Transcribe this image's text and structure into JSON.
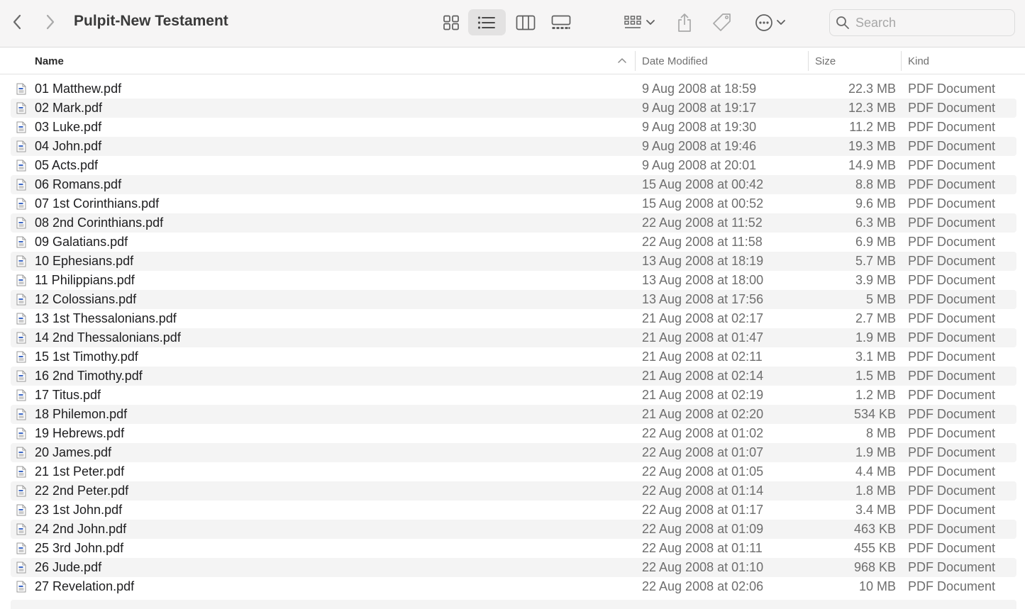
{
  "window": {
    "title": "Pulpit-New Testament"
  },
  "search": {
    "placeholder": "Search",
    "value": ""
  },
  "toolbar": {
    "icons": [
      "chevron-left-icon",
      "chevron-right-icon",
      "icon-view-icon",
      "list-view-icon",
      "column-view-icon",
      "gallery-view-icon",
      "group-icon",
      "share-icon",
      "tag-icon",
      "more-icon",
      "search-icon"
    ],
    "active_view": "list"
  },
  "columns": {
    "name": "Name",
    "date": "Date Modified",
    "size": "Size",
    "kind": "Kind",
    "sort_column": "name",
    "sort_direction": "ascending"
  },
  "files": [
    {
      "name": "01 Matthew.pdf",
      "date": "9 Aug 2008 at 18:59",
      "size": "22.3 MB",
      "kind": "PDF Document"
    },
    {
      "name": "02 Mark.pdf",
      "date": "9 Aug 2008 at 19:17",
      "size": "12.3 MB",
      "kind": "PDF Document"
    },
    {
      "name": "03 Luke.pdf",
      "date": "9 Aug 2008 at 19:30",
      "size": "11.2 MB",
      "kind": "PDF Document"
    },
    {
      "name": "04 John.pdf",
      "date": "9 Aug 2008 at 19:46",
      "size": "19.3 MB",
      "kind": "PDF Document"
    },
    {
      "name": "05 Acts.pdf",
      "date": "9 Aug 2008 at 20:01",
      "size": "14.9 MB",
      "kind": "PDF Document"
    },
    {
      "name": "06 Romans.pdf",
      "date": "15 Aug 2008 at 00:42",
      "size": "8.8 MB",
      "kind": "PDF Document"
    },
    {
      "name": "07 1st Corinthians.pdf",
      "date": "15 Aug 2008 at 00:52",
      "size": "9.6 MB",
      "kind": "PDF Document"
    },
    {
      "name": "08 2nd Corinthians.pdf",
      "date": "22 Aug 2008 at 11:52",
      "size": "6.3 MB",
      "kind": "PDF Document"
    },
    {
      "name": "09 Galatians.pdf",
      "date": "22 Aug 2008 at 11:58",
      "size": "6.9 MB",
      "kind": "PDF Document"
    },
    {
      "name": "10 Ephesians.pdf",
      "date": "13 Aug 2008 at 18:19",
      "size": "5.7 MB",
      "kind": "PDF Document"
    },
    {
      "name": "11 Philippians.pdf",
      "date": "13 Aug 2008 at 18:00",
      "size": "3.9 MB",
      "kind": "PDF Document"
    },
    {
      "name": "12 Colossians.pdf",
      "date": "13 Aug 2008 at 17:56",
      "size": "5 MB",
      "kind": "PDF Document"
    },
    {
      "name": "13 1st Thessalonians.pdf",
      "date": "21 Aug 2008 at 02:17",
      "size": "2.7 MB",
      "kind": "PDF Document"
    },
    {
      "name": "14 2nd Thessalonians.pdf",
      "date": "21 Aug 2008 at 01:47",
      "size": "1.9 MB",
      "kind": "PDF Document"
    },
    {
      "name": "15 1st Timothy.pdf",
      "date": "21 Aug 2008 at 02:11",
      "size": "3.1 MB",
      "kind": "PDF Document"
    },
    {
      "name": "16 2nd Timothy.pdf",
      "date": "21 Aug 2008 at 02:14",
      "size": "1.5 MB",
      "kind": "PDF Document"
    },
    {
      "name": "17 Titus.pdf",
      "date": "21 Aug 2008 at 02:19",
      "size": "1.2 MB",
      "kind": "PDF Document"
    },
    {
      "name": "18 Philemon.pdf",
      "date": "21 Aug 2008 at 02:20",
      "size": "534 KB",
      "kind": "PDF Document"
    },
    {
      "name": "19 Hebrews.pdf",
      "date": "22 Aug 2008 at 01:02",
      "size": "8 MB",
      "kind": "PDF Document"
    },
    {
      "name": "20 James.pdf",
      "date": "22 Aug 2008 at 01:07",
      "size": "1.9 MB",
      "kind": "PDF Document"
    },
    {
      "name": "21 1st Peter.pdf",
      "date": "22 Aug 2008 at 01:05",
      "size": "4.4 MB",
      "kind": "PDF Document"
    },
    {
      "name": "22 2nd Peter.pdf",
      "date": "22 Aug 2008 at 01:14",
      "size": "1.8 MB",
      "kind": "PDF Document"
    },
    {
      "name": "23 1st John.pdf",
      "date": "22 Aug 2008 at 01:17",
      "size": "3.4 MB",
      "kind": "PDF Document"
    },
    {
      "name": "24 2nd John.pdf",
      "date": "22 Aug 2008 at 01:09",
      "size": "463 KB",
      "kind": "PDF Document"
    },
    {
      "name": "25 3rd John.pdf",
      "date": "22 Aug 2008 at 01:11",
      "size": "455 KB",
      "kind": "PDF Document"
    },
    {
      "name": "26 Jude.pdf",
      "date": "22 Aug 2008 at 01:10",
      "size": "968 KB",
      "kind": "PDF Document"
    },
    {
      "name": "27 Revelation.pdf",
      "date": "22 Aug 2008 at 02:06",
      "size": "10 MB",
      "kind": "PDF Document"
    }
  ]
}
